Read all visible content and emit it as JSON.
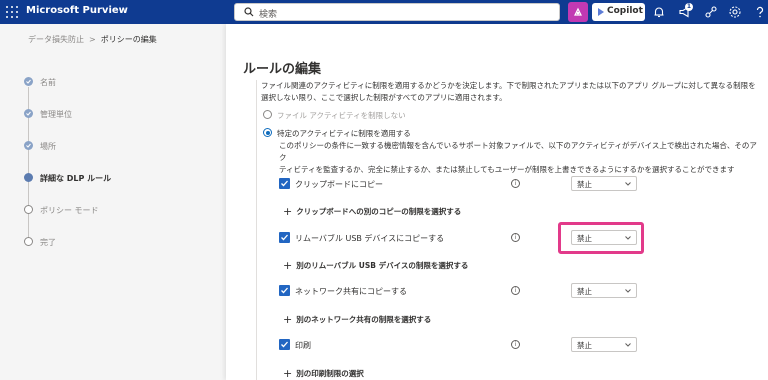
{
  "topbar": {
    "app_name": "Microsoft Purview",
    "search_placeholder": "検索",
    "copilot_label": "Copilot",
    "notification_count": "1",
    "colors": {
      "bar": "#0f3b91",
      "copilot_accent": "#c239b3"
    }
  },
  "breadcrumb": {
    "parent": "データ損失防止",
    "separator": ">",
    "current": "ポリシーの編集"
  },
  "steps": [
    {
      "label": "名前",
      "state": "done"
    },
    {
      "label": "管理単位",
      "state": "done"
    },
    {
      "label": "場所",
      "state": "done"
    },
    {
      "label": "詳細な DLP ルール",
      "state": "current"
    },
    {
      "label": "ポリシー モード",
      "state": "todo"
    },
    {
      "label": "完了",
      "state": "todo"
    }
  ],
  "main": {
    "title": "ルールの編集",
    "description_line1": "ファイル関連のアクティビティに制限を適用するかどうかを決定します。下で制限されたアプリまたは以下のアプリ グループに対して異なる制限を",
    "description_line2": "選択しない限り、ここで選択した制限がすべてのアプリに適用されます。",
    "radio_no_restrict": "ファイル アクティビティを制限しない",
    "radio_restrict": "特定のアクティビティに制限を適用する",
    "sub_description_line1": "このポリシーの条件に一致する機密情報を含んでいるサポート対象ファイルで、以下のアクティビティがデバイス上で検出された場合、そのアク",
    "sub_description_line2": "ティビティを監査するか、完全に禁止するか、または禁止してもユーザーが制限を上書きできるようにするかを選択することができます",
    "rules": [
      {
        "label": "クリップボードにコピー",
        "value": "禁止",
        "add_label": "クリップボードへの別のコピーの制限を選択する"
      },
      {
        "label": "リムーバブル USB デバイスにコピーする",
        "value": "禁止",
        "add_label": "別のリムーバブル USB デバイスの制限を選択する"
      },
      {
        "label": "ネットワーク共有にコピーする",
        "value": "禁止",
        "add_label": "別のネットワーク共有の制限を選択する"
      },
      {
        "label": "印刷",
        "value": "禁止",
        "add_label": "別の印刷制限の選択"
      }
    ],
    "info_glyph": "i",
    "plus_glyph": "+",
    "highlight_color": "#e23a8a"
  }
}
